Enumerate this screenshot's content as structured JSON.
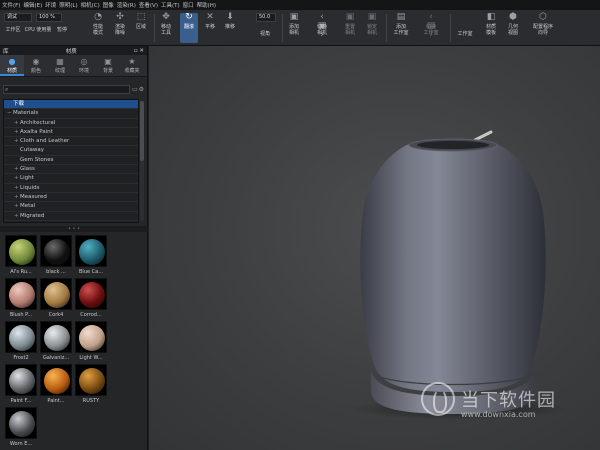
{
  "menu": [
    "文件(F)",
    "编辑(E)",
    "环境",
    "照明(L)",
    "相机(C)",
    "图像",
    "渲染(R)",
    "查看(V)",
    "工具(T)",
    "窗口",
    "帮助(H)"
  ],
  "toolbar": {
    "preset_value": "调试",
    "percent_value": "100 %",
    "workspace_label": "工作区",
    "cpu_label": "CPU 使用量",
    "pause_label": "暂停",
    "perf_mode_label": "性能\n模式",
    "denoise_label": "渲染\n降噪",
    "region_label": "区域",
    "move_tool_label": "移动\n工具",
    "rotate_label": "翻滚",
    "pan_label": "平移",
    "dolly_label": "推移",
    "fov_value": "50.0",
    "fov_label": "视角",
    "add_camera_label": "添加\n相机",
    "switch_camera_label": "切换\n相机",
    "reset_camera_label": "重置\n相机",
    "lock_camera_label": "锁定\n相机",
    "add_studio_label": "添加\n工作室",
    "switch_studio_label": "切换\n工作室",
    "studio_label": "工作室",
    "material_template_label": "材质\n模板",
    "geometry_view_label": "几何\n视图",
    "config_label": "配置程序\n向导"
  },
  "left_panel": {
    "title": "库",
    "subtitle": "材质",
    "tabs": [
      {
        "label": "材质",
        "icon": "sphere-icon"
      },
      {
        "label": "颜色",
        "icon": "palette-icon"
      },
      {
        "label": "纹理",
        "icon": "texture-icon"
      },
      {
        "label": "环境",
        "icon": "globe-icon"
      },
      {
        "label": "背景",
        "icon": "image-icon"
      },
      {
        "label": "收藏夹",
        "icon": "star-icon"
      }
    ],
    "tree": [
      {
        "label": "下载",
        "selected": true,
        "expandable": false,
        "child": false
      },
      {
        "label": "Materials",
        "selected": false,
        "expandable": true,
        "child": false
      },
      {
        "label": "Architectural",
        "selected": false,
        "expandable": true,
        "child": true
      },
      {
        "label": "Axalta Paint",
        "selected": false,
        "expandable": true,
        "child": true
      },
      {
        "label": "Cloth and Leather",
        "selected": false,
        "expandable": true,
        "child": true
      },
      {
        "label": "Cutaway",
        "selected": false,
        "expandable": false,
        "child": true
      },
      {
        "label": "Gem Stones",
        "selected": false,
        "expandable": false,
        "child": true
      },
      {
        "label": "Glass",
        "selected": false,
        "expandable": true,
        "child": true
      },
      {
        "label": "Light",
        "selected": false,
        "expandable": true,
        "child": true
      },
      {
        "label": "Liquids",
        "selected": false,
        "expandable": true,
        "child": true
      },
      {
        "label": "Measured",
        "selected": false,
        "expandable": true,
        "child": true
      },
      {
        "label": "Metal",
        "selected": false,
        "expandable": true,
        "child": true
      },
      {
        "label": "Migrated",
        "selected": false,
        "expandable": true,
        "child": true
      }
    ],
    "swatches": [
      {
        "label": "Al's Ru...",
        "color": "#6f8a3a",
        "color2": "#c9d27a"
      },
      {
        "label": "black ...",
        "color": "#101010",
        "color2": "#6b6b6b"
      },
      {
        "label": "Blue Ca...",
        "color": "#1e5a6b",
        "color2": "#4fb0c0"
      },
      {
        "label": "Blush P...",
        "color": "#b07a70",
        "color2": "#f0c8bc"
      },
      {
        "label": "Cork4",
        "color": "#a07840",
        "color2": "#e0c090"
      },
      {
        "label": "Corrod...",
        "color": "#6a0c0c",
        "color2": "#d05050"
      },
      {
        "label": "Frost2",
        "color": "#7c8a92",
        "color2": "#dfe6ea"
      },
      {
        "label": "Galvaniz...",
        "color": "#8a8e90",
        "color2": "#e8ecee"
      },
      {
        "label": "Light W...",
        "color": "#c0a08a",
        "color2": "#f2dccc"
      },
      {
        "label": "Paint F...",
        "color": "#606468",
        "color2": "#e0e4e8"
      },
      {
        "label": "Paint...",
        "color": "#b85c10",
        "color2": "#f8b450"
      },
      {
        "label": "RUSTY",
        "color": "#7a4a12",
        "color2": "#e0a040"
      },
      {
        "label": "Worn E...",
        "color": "#4a4c50",
        "color2": "#c8ccd0"
      }
    ]
  },
  "watermark": {
    "brand": "当下软件园",
    "url": "www.downxia.com"
  },
  "colors": {
    "accent": "#3c86d6",
    "selection": "#1f4f8c",
    "viewport_bg": "#404143"
  }
}
